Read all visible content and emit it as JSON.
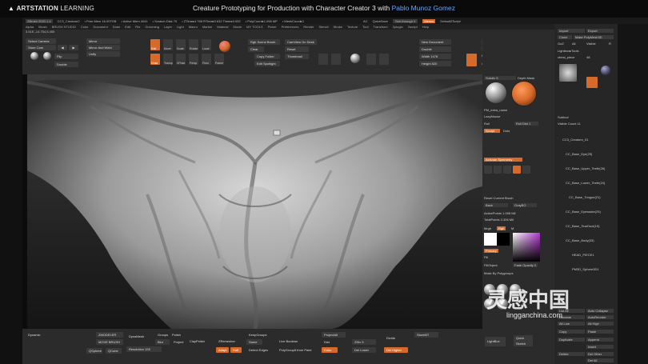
{
  "header": {
    "logo_brand": "ARTSTATION",
    "logo_suffix": "LEARNING",
    "title": "Creature Prototyping for Production with Character Creator 3",
    "title_with": "with",
    "author": "Pablo Munoz Gomez"
  },
  "status_bar": {
    "app": "ZBrush 2020.1.4",
    "file": "CC3_Creature2",
    "free_mem": "• Free Mem 16.007GB",
    "active_mem": "• Active Mem 4041",
    "scratch": "• Scratch Disk 70",
    "ztime": "• ZTime▸4.768 RTime▸0.632 Timer▸0.052",
    "polycount": "• PolyCount▸1.098 MP",
    "meshcount": "• MeshCount▸1",
    "ac": "AC",
    "quicksave": "QuickSave",
    "see_through": "See-through 0",
    "menus": "Menus",
    "default_zscript": "DefaultZScript"
  },
  "menus": [
    "Alpha",
    "Brush",
    "BRUSH STUDIO",
    "Color",
    "Document",
    "Draw",
    "Edit",
    "File",
    "Grooming",
    "Layer",
    "Light",
    "Macro",
    "Marker",
    "Material",
    "Movie",
    "MY TOOLS",
    "Picker",
    "Preferences",
    "Render",
    "Stencil",
    "Stroke",
    "Texture",
    "Tool",
    "Transform",
    "Zplugin",
    "Zscript",
    "Help"
  ],
  "coords": "3.51E,-14.754,5.455",
  "tools": {
    "select_camera": "Select Camera",
    "store_cam": "Store Cam",
    "flip": "Flip",
    "double": "Double",
    "mirror": "Mirror",
    "mirror_weld": "Mirror And Weld",
    "unify": "Unify",
    "edit": "Edit",
    "draw": "Draw",
    "move": "Move",
    "scale": "Scale",
    "rotate": "Rotate",
    "local": "Local",
    "transp": "Transp",
    "xpose": "XPose",
    "persp": "Persp",
    "floor": "Floor",
    "frame": "Frame",
    "rgb_scene_brush": "Rgb Scene Brush",
    "clear": "Clear",
    "copy_folder": "Copy Folder",
    "edit_spotlight": "Edit Spotlight",
    "camview_on_desk": "CamView On Desk",
    "reset": "Reset",
    "thumbnail": "Thumbnail",
    "new_document": "New Document",
    "double_btn": "Double",
    "width": "Width 1476",
    "height": "Height 820",
    "quick_render_test": "Quick Render Test",
    "bpr": "BPR",
    "spix": "SPix 3",
    "back_to_sculpt": "Back To Sculpt",
    "repeat": "Repeat",
    "groups_by_materials": "Groups By Materials"
  },
  "right_panel": {
    "subdiv": "Subdiv 5",
    "depth_mask": "Depth Mask",
    "pm_extra_name": "PM_extra_name",
    "laz_mouse": "LazyMouse",
    "roll": "Roll",
    "roll_dist": "Roll Dist 1",
    "sculpt": "Sculpt",
    "dots": "Dots",
    "activate_symmetry": "Activate Symmetry",
    "reset_current_brush": "Reset Current Brush",
    "back": "Back",
    "gray_bg": "GrayBG",
    "active_points": "ActivePoints 1.098 Mil",
    "total_points": "TotalPoints 3.306 Mil",
    "mrgb": "Mrgb",
    "rgb": "Rgb",
    "m": "M",
    "primary": "Primary",
    "fill": "Fill",
    "fill_object": "FillObject",
    "fade_opacity": "Fade Opacity 0",
    "mask_by_polygroups": "Mask By Polygroups",
    "lightbox": "LightBox",
    "quick_sketch": "Quick Sketch"
  },
  "far_panel": {
    "import": "Import",
    "export": "Export",
    "clone": "Clone",
    "make_polymesh": "Make PolyMesh3D",
    "goz": "GoZ",
    "all": "All",
    "visible": "Visible",
    "r": "R",
    "lightbox_tools": "Lightbox▸Tools",
    "chest_piece": "chest_piece",
    "chest_value": "48",
    "subtool_header": "Subtool",
    "visible_count": "Visible Count 11",
    "items": [
      "CC3_Creature_01",
      "CC_Base_Eye(29)",
      "CC_Base_Upper_Teeth(26)",
      "CC_Base_Lower_Teeth(24)",
      "CC_Base_Tongue(21)",
      "CC_Base_Eyewaste(25)",
      "CC_Base_TearDuct(19)",
      "CC_Base_Body(33)",
      "HEAD_PIECE1",
      "PM3D_Sphere3D1"
    ],
    "list_all": "List All",
    "auto_collapse": "Auto Collapse",
    "rename": "Rename",
    "auto_reorder": "AutoReorder",
    "all_low": "All Low",
    "all_high": "All High",
    "copy": "Copy",
    "paste": "Paste",
    "duplicate": "Duplicate",
    "append": "Append",
    "insert": "Insert",
    "delete": "Delete",
    "del_other": "Del Other",
    "del_all": "Del All"
  },
  "bottom": {
    "dynamic": "Dynamic",
    "zmodeler": "ZMODELER",
    "move_brush": "MOVE BRUSH",
    "dynamesh": "DynaMesh",
    "groups": "Groups",
    "polish": "Polish",
    "blur": "Blur",
    "project": "Project",
    "resolution": "Resolution 128",
    "clay_polish": "ClayPolish",
    "zremesher": "ZRemesher",
    "keep_groups": "KeepGroups",
    "adapt": "Adapt",
    "half": "Half",
    "same": "Same",
    "detect_edges": "Detect Edges",
    "live_boolean": "Live Boolean",
    "polygroupit": "PolyGroupIt from Paint",
    "project_all": "ProjectAll",
    "dist": "Dist",
    "divide": "Divide",
    "store_mt": "StoreMT",
    "zdiv": "ZDiv 5",
    "del_lower": "Del Lower",
    "del_higher": "Del Higher",
    "qsphere": "QSphere",
    "qcube": "QCube",
    "color": "Color"
  },
  "watermark": {
    "main": "灵感中国",
    "sub": "lingganchina.com"
  },
  "colors": {
    "accent": "#d66a2a",
    "link": "#6aa6ff",
    "panel": "#2b2b2b",
    "picker_hue": "#b33ad1"
  }
}
